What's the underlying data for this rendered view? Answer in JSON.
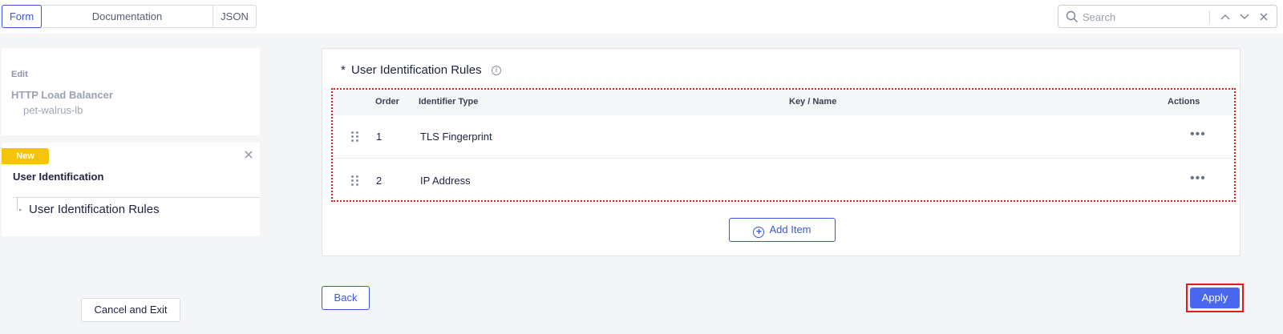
{
  "tabs": [
    {
      "label": "Form",
      "active": true
    },
    {
      "label": "Documentation",
      "active": false
    },
    {
      "label": "JSON",
      "active": false
    }
  ],
  "search": {
    "placeholder": "Search"
  },
  "sidebar": {
    "edit_label": "Edit",
    "object_type": "HTTP Load Balancer",
    "object_name": "pet-walrus-lb",
    "badge": "New",
    "section_title": "User Identification",
    "section_link": "User Identification Rules"
  },
  "footer": {
    "cancel_label": "Cancel and Exit",
    "back_label": "Back",
    "apply_label": "Apply"
  },
  "main": {
    "required_marker": "*",
    "title": "User Identification Rules",
    "info_glyph": "i",
    "columns": [
      "Order",
      "Identifier Type",
      "Key / Name",
      "Actions"
    ],
    "rows": [
      {
        "order": "1",
        "identifier_type": "TLS Fingerprint",
        "key_name": "",
        "actions": "•••"
      },
      {
        "order": "2",
        "identifier_type": "IP Address",
        "key_name": "",
        "actions": "•••"
      }
    ],
    "add_item_label": "Add Item"
  },
  "colors": {
    "accent": "#3c57d6",
    "apply_bg": "#4a67f0",
    "badge": "#f6c30b",
    "highlight": "#e0191b"
  }
}
